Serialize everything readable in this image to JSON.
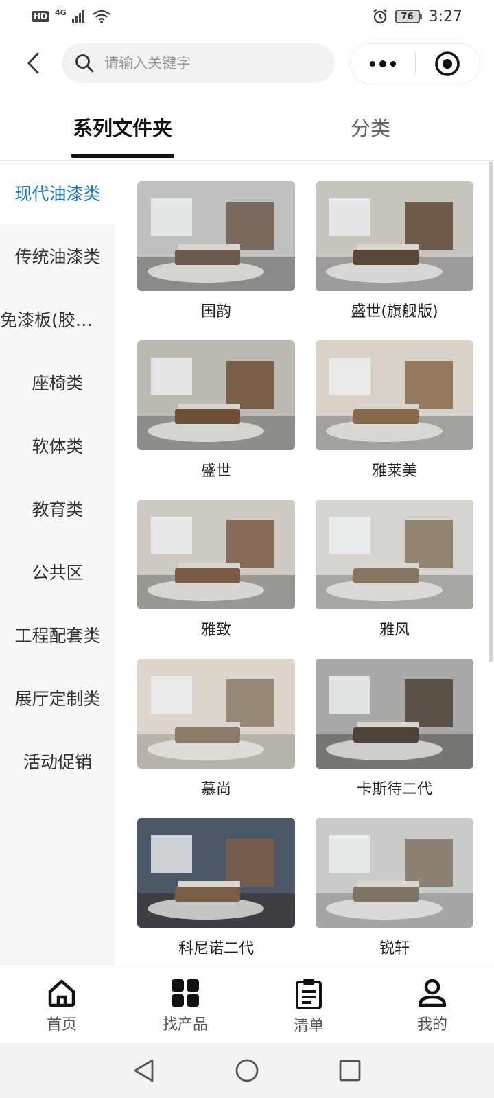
{
  "status_bar": {
    "hd_label": "HD",
    "network_label": "4G",
    "battery_level": "76",
    "time": "3:27"
  },
  "search": {
    "placeholder": "请输入关键字"
  },
  "tabs": [
    {
      "label": "系列文件夹",
      "active": true
    },
    {
      "label": "分类",
      "active": false
    }
  ],
  "sidebar": {
    "items": [
      {
        "label": "现代油漆类",
        "active": true
      },
      {
        "label": "传统油漆类",
        "active": false
      },
      {
        "label": "免漆板(胶…",
        "active": false
      },
      {
        "label": "座椅类",
        "active": false
      },
      {
        "label": "软体类",
        "active": false
      },
      {
        "label": "教育类",
        "active": false
      },
      {
        "label": "公共区",
        "active": false
      },
      {
        "label": "工程配套类",
        "active": false
      },
      {
        "label": "展厅定制类",
        "active": false
      },
      {
        "label": "活动促销",
        "active": false
      }
    ]
  },
  "products": [
    {
      "name": "国韵",
      "palette": [
        "#bfc0c0",
        "#6b5a4d",
        "#8a8a88"
      ]
    },
    {
      "name": "盛世(旗舰版)",
      "palette": [
        "#c8c4be",
        "#5c4636",
        "#9c9c9a"
      ]
    },
    {
      "name": "盛世",
      "palette": [
        "#bdbab4",
        "#6e4e36",
        "#8e8d89"
      ]
    },
    {
      "name": "雅莱美",
      "palette": [
        "#d8d2c8",
        "#8a6a4c",
        "#a3a19b"
      ]
    },
    {
      "name": "雅致",
      "palette": [
        "#cfcac2",
        "#7a5c46",
        "#9a9892"
      ]
    },
    {
      "name": "雅风",
      "palette": [
        "#d6d4cf",
        "#857560",
        "#a9a7a1"
      ]
    },
    {
      "name": "慕尚",
      "palette": [
        "#ddd6cc",
        "#8c7a66",
        "#b8b3ab"
      ]
    },
    {
      "name": "卡斯待二代",
      "palette": [
        "#a9a9a7",
        "#4e4338",
        "#777672"
      ]
    },
    {
      "name": "科尼诺二代",
      "palette": [
        "#4b5666",
        "#7b5e48",
        "#3d3f44"
      ]
    },
    {
      "name": "锐轩",
      "palette": [
        "#c9ccc9",
        "#807466",
        "#a3a6a3"
      ]
    }
  ],
  "bottom_tabs": [
    {
      "label": "首页",
      "icon": "home-icon"
    },
    {
      "label": "找产品",
      "icon": "grid-icon"
    },
    {
      "label": "清单",
      "icon": "clipboard-icon"
    },
    {
      "label": "我的",
      "icon": "user-icon"
    }
  ]
}
